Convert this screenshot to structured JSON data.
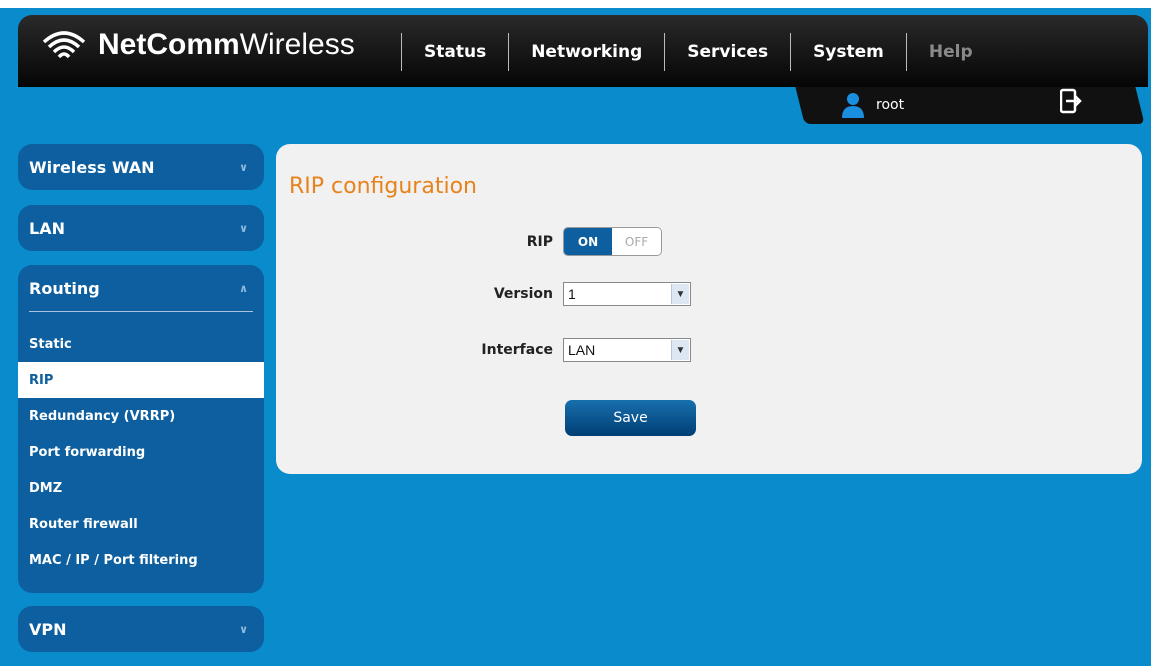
{
  "brand": {
    "bold": "NetComm",
    "light": "Wireless"
  },
  "nav": [
    "Status",
    "Networking",
    "Services",
    "System",
    "Help"
  ],
  "user": {
    "name": "root"
  },
  "sidebar": {
    "wireless_wan": "Wireless WAN",
    "lan": "LAN",
    "routing": "Routing",
    "routing_items": [
      "Static",
      "RIP",
      "Redundancy (VRRP)",
      "Port forwarding",
      "DMZ",
      "Router firewall",
      "MAC / IP / Port filtering"
    ],
    "vpn": "VPN"
  },
  "panel": {
    "title": "RIP configuration",
    "rip_label": "RIP",
    "rip_on": "ON",
    "rip_off": "OFF",
    "version_label": "Version",
    "version_value": "1",
    "interface_label": "Interface",
    "interface_value": "LAN",
    "save": "Save"
  },
  "colors": {
    "accent": "#e8821b",
    "sidebar": "#0d5f9f",
    "background": "#0a8ccc"
  }
}
